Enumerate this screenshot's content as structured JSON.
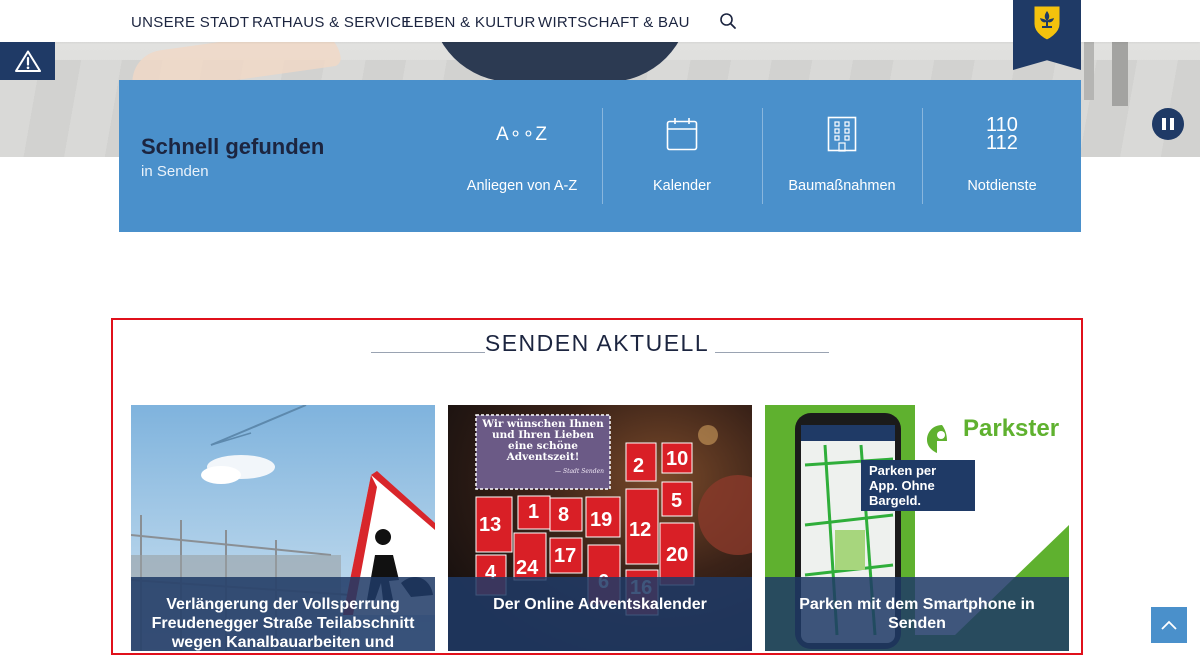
{
  "nav": {
    "items": [
      "UNSERE STADT",
      "RATHAUS & SERVICE",
      "LEBEN & KULTUR",
      "WIRTSCHAFT & BAU"
    ],
    "search_icon": "search-icon",
    "logo_icon": "city-crest-icon"
  },
  "hero": {
    "alert_icon": "warning-triangle-icon",
    "pause_icon": "pause-icon"
  },
  "quick": {
    "title": "Schnell gefunden",
    "subtitle": "in Senden",
    "items": [
      {
        "label": "Anliegen von A-Z",
        "icon": "a-to-z-icon",
        "glyph": "A∘∘Z"
      },
      {
        "label": "Kalender",
        "icon": "calendar-icon"
      },
      {
        "label": "Baumaßnahmen",
        "icon": "building-icon"
      },
      {
        "label": "Notdienste",
        "icon": "emergency-numbers-icon",
        "line1": "110",
        "line2": "112"
      }
    ]
  },
  "news": {
    "title": "SENDEN AKTUELL",
    "cards": [
      {
        "caption": "Verlängerung der Vollsperrung Freudenegger Straße Teilabschnitt wegen Kanalbauarbeiten und"
      },
      {
        "caption": "Der Online Adventskalender",
        "banner": "Wir wünschen Ihnen und Ihren Lieben eine schöne Adventszeit!",
        "banner_sign": "— Stadt Senden",
        "doors": [
          "2",
          "10",
          "5",
          "1",
          "8",
          "19",
          "13",
          "12",
          "24",
          "17",
          "20",
          "4",
          "6",
          "16"
        ]
      },
      {
        "caption": "Parken mit dem Smartphone in Senden",
        "brand": "Parkster",
        "bubble": "Parken per App. Ohne Bargeld."
      }
    ]
  },
  "back_to_top_icon": "chevron-up-icon",
  "colors": {
    "brand_navy": "#1f3a66",
    "quick_blue": "#4a90cb",
    "highlight_red": "#e0101b",
    "parkster_green": "#5fb12f"
  }
}
